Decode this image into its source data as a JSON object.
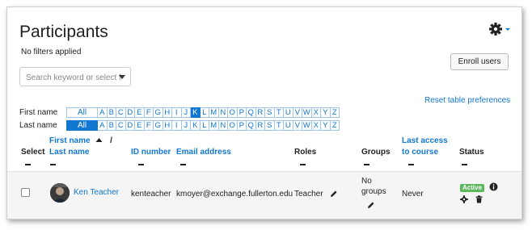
{
  "header": {
    "title": "Participants",
    "filters_text": "No filters applied",
    "enroll_label": "Enroll users"
  },
  "search": {
    "placeholder": "Search keyword or select filter"
  },
  "initials": {
    "reset_label": "Reset table preferences",
    "first_name_label": "First name",
    "last_name_label": "Last name",
    "all_label": "All",
    "letters": [
      "A",
      "B",
      "C",
      "D",
      "E",
      "F",
      "G",
      "H",
      "I",
      "J",
      "K",
      "L",
      "M",
      "N",
      "O",
      "P",
      "Q",
      "R",
      "S",
      "T",
      "U",
      "V",
      "W",
      "X",
      "Y",
      "Z"
    ],
    "first_selected": "K",
    "last_selected": "All"
  },
  "table": {
    "headers": {
      "select": "Select",
      "first_name": "First name",
      "slash": "/",
      "last_name": "Last name",
      "id_number": "ID number",
      "email": "Email address",
      "roles": "Roles",
      "groups": "Groups",
      "last_access_1": "Last access",
      "last_access_2": "to course",
      "status": "Status"
    },
    "rows": [
      {
        "name": "Ken Teacher",
        "id_number": "kenteacher",
        "email": "kmoyer@exchange.fullerton.edu",
        "role": "Teacher",
        "groups_1": "No",
        "groups_2": "groups",
        "last_access": "Never",
        "status": "Active"
      }
    ]
  },
  "icons": {
    "gear": "gear-icon",
    "pencil": "pencil-icon",
    "info": "info-icon",
    "trash": "trash-icon",
    "sort": "sort-ascending-icon"
  },
  "colors": {
    "link": "#1177d1",
    "active_badge": "#5cb85c"
  }
}
